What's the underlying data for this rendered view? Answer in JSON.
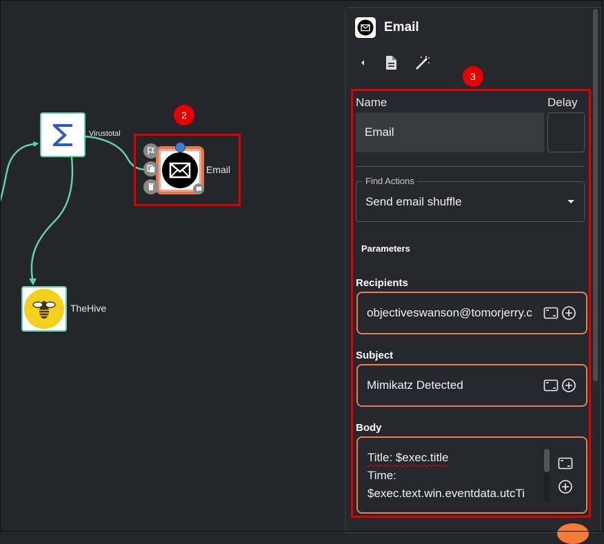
{
  "canvas": {
    "nodes": {
      "virustotal": {
        "label": "Virustotal",
        "icon": "sigma-icon"
      },
      "email": {
        "label": "Email",
        "icon": "envelope-icon"
      },
      "thehive": {
        "label": "TheHive",
        "icon": "bee-icon"
      }
    },
    "badges": {
      "node_badge": "2",
      "panel_badge": "3"
    },
    "edge_color": "#5fd4a6",
    "highlight_color": "#e00000"
  },
  "panel": {
    "title": "Email",
    "toolbar": [
      "collapse-arrow-icon",
      "document-icon",
      "magic-wand-icon"
    ],
    "name_label": "Name",
    "delay_label": "Delay",
    "name_value": "Email",
    "delay_value": "",
    "find_actions_legend": "Find Actions",
    "find_actions_value": "Send email shuffle",
    "parameters_heading": "Parameters",
    "recipients": {
      "label": "Recipients",
      "value": "objectiveswanson@tomorjerry.c"
    },
    "subject": {
      "label": "Subject",
      "value": "Mimikatz Detected"
    },
    "body": {
      "label": "Body",
      "lines": [
        "Title: $exec.title",
        "Time:",
        "$exec.text.win.eventdata.utcTi"
      ]
    }
  },
  "colors": {
    "field_border": "#e8805c",
    "accent": "#f47b33"
  }
}
